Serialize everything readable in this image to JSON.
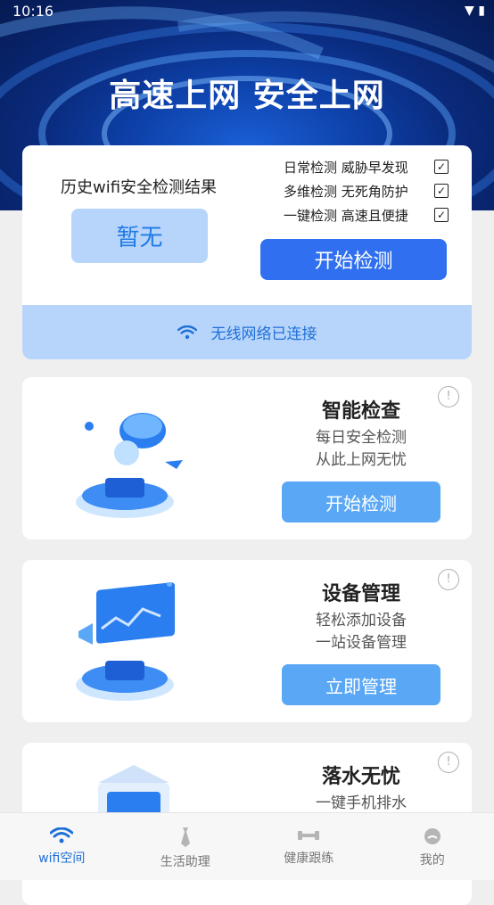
{
  "status_bar": {
    "time": "10:16"
  },
  "hero": {
    "title": "高速上网 安全上网"
  },
  "top_card": {
    "history_label": "历史wifi安全检测结果",
    "history_value": "暂无",
    "checks": [
      "日常检测 威胁早发现",
      "多维检测 无死角防护",
      "一键检测 高速且便捷"
    ],
    "start_button": "开始检测",
    "connected_text": "无线网络已连接"
  },
  "features": [
    {
      "title": "智能检查",
      "desc1": "每日安全检测",
      "desc2": "从此上网无忧",
      "button": "开始检测"
    },
    {
      "title": "设备管理",
      "desc1": "轻松添加设备",
      "desc2": "一站设备管理",
      "button": "立即管理"
    },
    {
      "title": "落水无忧",
      "desc1": "一键手机排水",
      "desc2": "",
      "button": ""
    }
  ],
  "bottom_nav": [
    {
      "label": "wifi空间",
      "active": true
    },
    {
      "label": "生活助理",
      "active": false
    },
    {
      "label": "健康跟练",
      "active": false
    },
    {
      "label": "我的",
      "active": false
    }
  ],
  "colors": {
    "primary": "#2f6ff0",
    "accent_light": "#b7d5fb",
    "nav_active": "#1f6fd8"
  }
}
